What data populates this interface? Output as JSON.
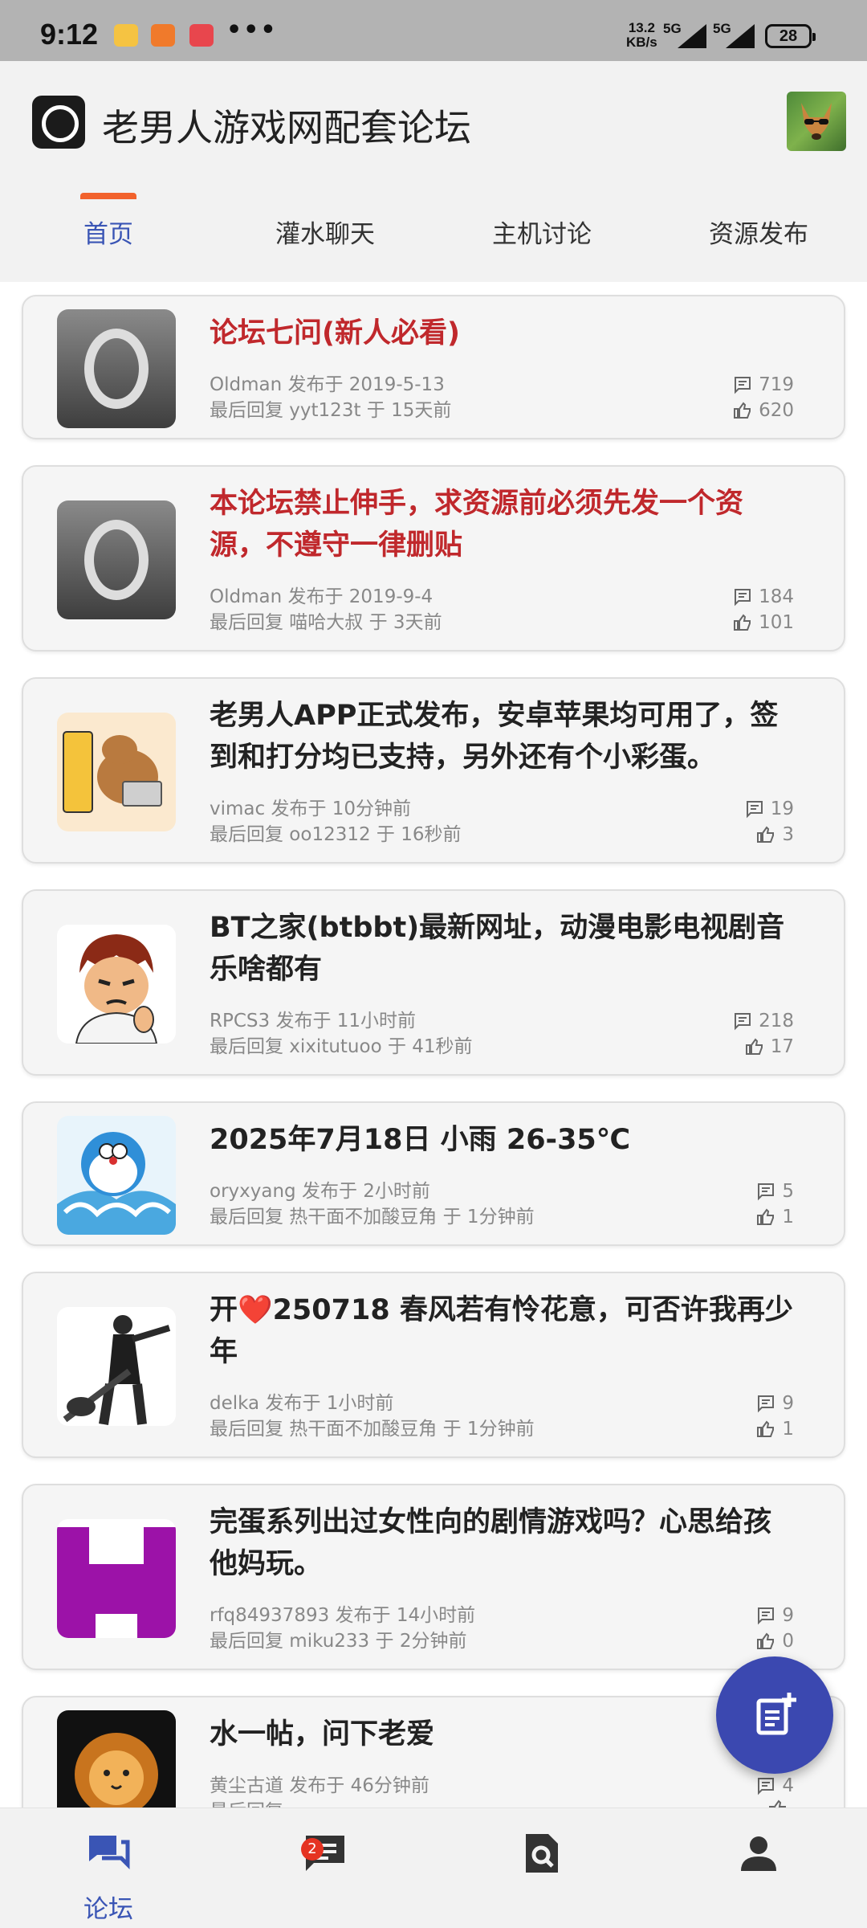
{
  "status_bar": {
    "time": "9:12",
    "more": "•••",
    "speed_value": "13.2",
    "speed_unit": "KB/s",
    "network1": "5G",
    "network2": "5G",
    "battery": "28"
  },
  "header": {
    "title": "老男人游戏网配套论坛"
  },
  "tabs": [
    {
      "label": "首页",
      "active": true
    },
    {
      "label": "灌水聊天",
      "active": false
    },
    {
      "label": "主机讨论",
      "active": false
    },
    {
      "label": "资源发布",
      "active": false
    }
  ],
  "accent_color": "#3a55b5",
  "indicator_color": "#f2622c",
  "pinned_color": "#c0282c",
  "posts": [
    {
      "title": "论坛七问(新人必看)",
      "pinned": true,
      "meta1": "Oldman 发布于 2019-5-13",
      "meta2": "最后回复 yyt123t 于 15天前",
      "comments": "719",
      "likes": "620"
    },
    {
      "title": "本论坛禁止伸手，求资源前必须先发一个资源，不遵守一律删贴",
      "pinned": true,
      "meta1": "Oldman 发布于 2019-9-4",
      "meta2": "最后回复 喵哈大叔 于 3天前",
      "comments": "184",
      "likes": "101"
    },
    {
      "title": "老男人APP正式发布，安卓苹果均可用了，签到和打分均已支持，另外还有个小彩蛋。",
      "pinned": false,
      "meta1": "vimac 发布于 10分钟前",
      "meta2": "最后回复 oo12312 于 16秒前",
      "comments": "19",
      "likes": "3"
    },
    {
      "title": "BT之家(btbbt)最新网址，动漫电影电视剧音乐啥都有",
      "pinned": false,
      "meta1": "RPCS3 发布于 11小时前",
      "meta2": "最后回复 xixitutuoo 于 41秒前",
      "comments": "218",
      "likes": "17"
    },
    {
      "title": "2025年7月18日 小雨 26-35℃",
      "pinned": false,
      "meta1": "oryxyang 发布于 2小时前",
      "meta2": "最后回复 热干面不加酸豆角 于 1分钟前",
      "comments": "5",
      "likes": "1"
    },
    {
      "title": "开❤️250718 春风若有怜花意，可否许我再少年",
      "pinned": false,
      "meta1": "delka 发布于 1小时前",
      "meta2": "最后回复 热干面不加酸豆角 于 1分钟前",
      "comments": "9",
      "likes": "1"
    },
    {
      "title": "完蛋系列出过女性向的剧情游戏吗？心思给孩他妈玩。",
      "pinned": false,
      "meta1": "rfq84937893 发布于 14小时前",
      "meta2": "最后回复 miku233 于 2分钟前",
      "comments": "9",
      "likes": "0"
    },
    {
      "title": "水一帖，问下老爱",
      "pinned": false,
      "meta1": "黄尘古道 发布于 46分钟前",
      "meta2": "最后回复 ...",
      "comments": "4",
      "likes": ""
    }
  ],
  "bottom_nav": {
    "forum_label": "论坛",
    "messages_badge": "2"
  }
}
